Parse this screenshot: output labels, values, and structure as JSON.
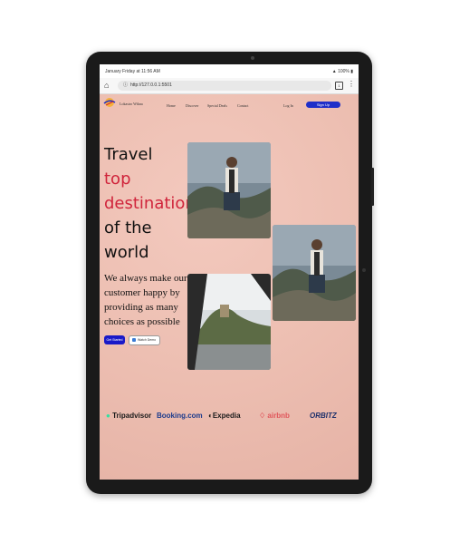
{
  "status": {
    "time": "January Friday at 11:56 AM",
    "battery": "100%"
  },
  "browser": {
    "url": "http://127.0.0.1:5501"
  },
  "nav": {
    "brand": "Lokastro Wikna",
    "links": [
      "Home",
      "Discover",
      "Special Deals",
      "Contact"
    ],
    "login": "Log In",
    "signup": "Sign Up"
  },
  "hero": {
    "line1": "Travel",
    "line2": "top",
    "line3": "destination",
    "line4": "of the",
    "line5": "world",
    "subtitle": "We always make our customer happy by providing as many choices as possible",
    "btn_start": "Get Started",
    "btn_watch": "Watch Demo"
  },
  "partners": [
    "Tripadvisor",
    "Booking.com",
    "Expedia",
    "airbnb",
    "ORBITZ"
  ],
  "colors": {
    "accent": "#d0243b",
    "primary": "#1919c8",
    "background": "#edbfb2"
  }
}
